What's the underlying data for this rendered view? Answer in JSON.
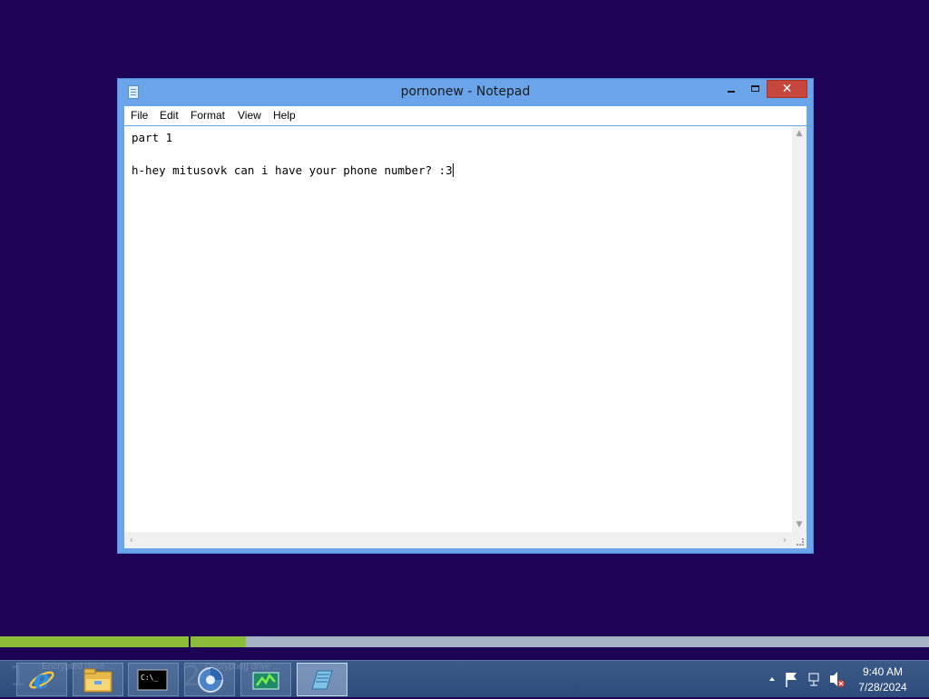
{
  "window": {
    "title": "pornonew - Notepad",
    "close_glyph": "✕"
  },
  "menubar": {
    "items": [
      "File",
      "Edit",
      "Format",
      "View",
      "Help"
    ]
  },
  "document": {
    "line1": "part 1",
    "line2": "",
    "line3": "h-hey mitusovk can i have your phone number? :3"
  },
  "taskbar": {
    "ghost_numbers": [
      "1",
      "2"
    ],
    "ghost_texts": [
      "Encrypted drive ...",
      "Decrypting drive ..."
    ],
    "apps": [
      "internet-explorer-icon",
      "file-explorer-icon",
      "command-prompt-icon",
      "browser-icon",
      "task-manager-icon",
      "notepad-icon"
    ],
    "clock_time": "9:40 AM",
    "clock_date": "7/28/2024"
  },
  "progress": {
    "bar1_fraction": 1.0,
    "bar2_fraction": 0.075
  },
  "colors": {
    "desktop": "#1d0256",
    "window_frame": "#6aa5ec",
    "close_button": "#c7463d",
    "progress_fill": "#8bbd38"
  }
}
